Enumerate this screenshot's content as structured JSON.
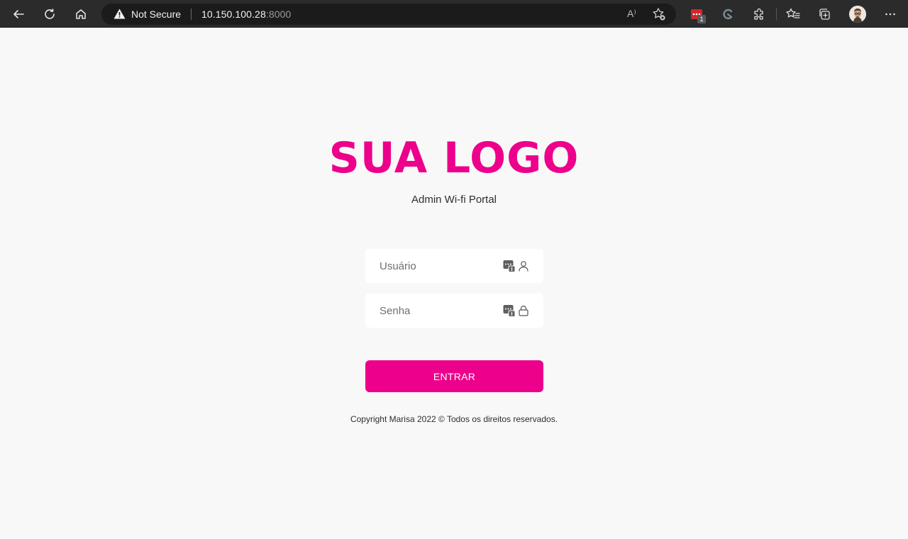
{
  "browser": {
    "security_label": "Not Secure",
    "url_host": "10.150.100.28",
    "url_port": ":8000",
    "extension_badge": "1",
    "read_aloud_glyph": "A⁾",
    "icons": [
      "back-icon",
      "refresh-icon",
      "home-icon",
      "warning-icon",
      "read-aloud-icon",
      "add-favorite-icon",
      "password-extension-icon",
      "grammar-extension-icon",
      "extensions-icon",
      "favorites-icon",
      "collections-icon",
      "profile-avatar",
      "more-icon"
    ]
  },
  "page": {
    "logo": "SUA LOGO",
    "subtitle": "Admin Wi-fi Portal",
    "username_placeholder": "Usuário",
    "password_placeholder": "Senha",
    "submit_label": "ENTRAR",
    "copyright": "Copyright Marisa 2022 © Todos os direitos reservados."
  },
  "colors": {
    "brand": "#ec008c",
    "page_background": "#f8f8f8",
    "toolbar": "#2b2b2b"
  }
}
